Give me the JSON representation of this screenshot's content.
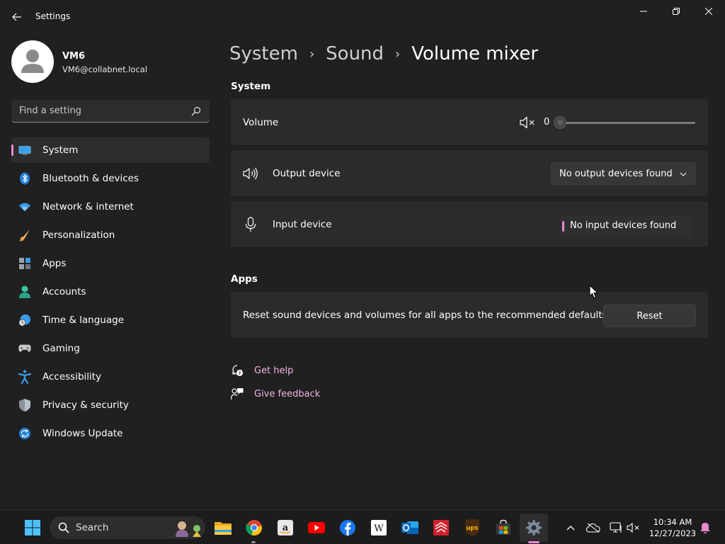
{
  "window": {
    "title": "Settings"
  },
  "profile": {
    "name": "VM6",
    "email": "VM6@collabnet.local"
  },
  "search": {
    "placeholder": "Find a setting"
  },
  "nav": {
    "items": [
      {
        "label": "System",
        "icon": "system-icon",
        "active": true
      },
      {
        "label": "Bluetooth & devices",
        "icon": "bluetooth-icon"
      },
      {
        "label": "Network & internet",
        "icon": "wifi-icon"
      },
      {
        "label": "Personalization",
        "icon": "brush-icon"
      },
      {
        "label": "Apps",
        "icon": "apps-icon"
      },
      {
        "label": "Accounts",
        "icon": "account-icon"
      },
      {
        "label": "Time & language",
        "icon": "clock-globe-icon"
      },
      {
        "label": "Gaming",
        "icon": "gamepad-icon"
      },
      {
        "label": "Accessibility",
        "icon": "accessibility-icon"
      },
      {
        "label": "Privacy & security",
        "icon": "shield-icon"
      },
      {
        "label": "Windows Update",
        "icon": "update-icon"
      }
    ]
  },
  "breadcrumb": {
    "items": [
      "System",
      "Sound"
    ],
    "current": "Volume mixer"
  },
  "system_section": {
    "title": "System",
    "volume_label": "Volume",
    "volume_value": "0",
    "volume_level": 0,
    "output_label": "Output device",
    "output_value": "No output devices found",
    "input_label": "Input device",
    "input_value": "No input devices found"
  },
  "apps_section": {
    "title": "Apps",
    "reset_description": "Reset sound devices and volumes for all apps to the recommended defaults",
    "reset_button": "Reset"
  },
  "links": {
    "get_help": "Get help",
    "give_feedback": "Give feedback"
  },
  "taskbar": {
    "search_label": "Search",
    "apps": [
      "file-explorer-icon",
      "chrome-icon",
      "amazon-icon",
      "youtube-icon",
      "facebook-icon",
      "wikipedia-icon",
      "outlook-icon",
      "bank-icon",
      "ups-icon",
      "store-icon",
      "settings-icon"
    ],
    "time": "10:34 AM",
    "date": "12/27/2023"
  },
  "colors": {
    "accent": "#e88ad0",
    "background": "#202020",
    "card": "#2b2b2b"
  }
}
